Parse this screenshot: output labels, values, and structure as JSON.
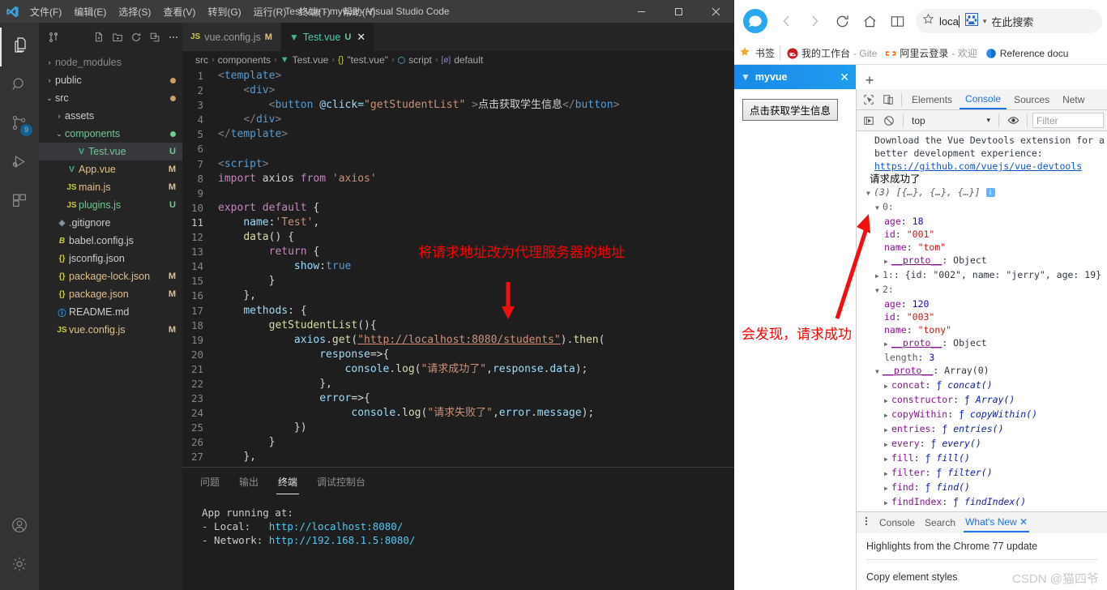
{
  "vscode": {
    "window_title": "Test.vue - myvue - Visual Studio Code",
    "menu": [
      {
        "label": "文件(F)"
      },
      {
        "label": "编辑(E)"
      },
      {
        "label": "选择(S)"
      },
      {
        "label": "查看(V)"
      },
      {
        "label": "转到(G)"
      },
      {
        "label": "运行(R)"
      },
      {
        "label": "终端(T)"
      },
      {
        "label": "帮助(H)"
      }
    ],
    "window_controls": {
      "minimize": "—",
      "maximize": "▭",
      "close": "✕"
    },
    "activitybar": [
      {
        "name": "explorer",
        "icon": "files-icon",
        "badge": ""
      },
      {
        "name": "search",
        "icon": "search-icon",
        "badge": ""
      },
      {
        "name": "source-control",
        "icon": "source-control-icon",
        "badge": "9"
      },
      {
        "name": "run-debug",
        "icon": "run-debug-icon",
        "badge": ""
      },
      {
        "name": "extensions",
        "icon": "extensions-icon",
        "badge": ""
      }
    ],
    "activitybar_bottom": [
      {
        "name": "account",
        "icon": "account-icon"
      },
      {
        "name": "manage",
        "icon": "gear-icon"
      }
    ],
    "explorer_actions": [
      {
        "icon": "new-file-icon"
      },
      {
        "icon": "new-folder-icon"
      },
      {
        "icon": "refresh-icon"
      },
      {
        "icon": "collapse-all-icon"
      },
      {
        "icon": "more-actions-icon"
      }
    ],
    "tree": [
      {
        "label": "node_modules",
        "chevron": "›",
        "icon": "",
        "indent": 0,
        "badge": "",
        "dot": "",
        "color": "#8a8a8a",
        "selected": false
      },
      {
        "label": "public",
        "chevron": "›",
        "icon": "",
        "indent": 0,
        "badge": "",
        "dot": "#c9a06a",
        "color": "#cccccc",
        "selected": false
      },
      {
        "label": "src",
        "chevron": "⌄",
        "icon": "",
        "indent": 0,
        "badge": "",
        "dot": "#c9a06a",
        "color": "#cccccc",
        "selected": false
      },
      {
        "label": "assets",
        "chevron": "›",
        "icon": "",
        "indent": 1,
        "badge": "",
        "dot": "",
        "color": "#cccccc",
        "selected": false
      },
      {
        "label": "components",
        "chevron": "⌄",
        "icon": "",
        "indent": 1,
        "badge": "",
        "dot": "#73c991",
        "color": "#73c991",
        "selected": false
      },
      {
        "label": "Test.vue",
        "chevron": "",
        "icon": "V",
        "indent": 2,
        "badge": "U",
        "dot": "",
        "color": "#73c991",
        "selected": true
      },
      {
        "label": "App.vue",
        "chevron": "",
        "icon": "V",
        "indent": 1,
        "badge": "M",
        "dot": "",
        "color": "#e2c08d",
        "selected": false
      },
      {
        "label": "main.js",
        "chevron": "",
        "icon": "JS",
        "indent": 1,
        "badge": "M",
        "dot": "",
        "color": "#e2c08d",
        "selected": false
      },
      {
        "label": "plugins.js",
        "chevron": "",
        "icon": "JS",
        "indent": 1,
        "badge": "U",
        "dot": "",
        "color": "#73c991",
        "selected": false
      },
      {
        "label": ".gitignore",
        "chevron": "",
        "icon": "◈",
        "indent": 0,
        "badge": "",
        "dot": "",
        "color": "#cccccc",
        "selected": false
      },
      {
        "label": "babel.config.js",
        "chevron": "",
        "icon": "B",
        "indent": 0,
        "badge": "",
        "dot": "",
        "color": "#cccccc",
        "selected": false
      },
      {
        "label": "jsconfig.json",
        "chevron": "",
        "icon": "{}",
        "indent": 0,
        "badge": "",
        "dot": "",
        "color": "#cccccc",
        "selected": false
      },
      {
        "label": "package-lock.json",
        "chevron": "",
        "icon": "{}",
        "indent": 0,
        "badge": "M",
        "dot": "",
        "color": "#e2c08d",
        "selected": false
      },
      {
        "label": "package.json",
        "chevron": "",
        "icon": "{}",
        "indent": 0,
        "badge": "M",
        "dot": "",
        "color": "#e2c08d",
        "selected": false
      },
      {
        "label": "README.md",
        "chevron": "",
        "icon": "ⓘ",
        "indent": 0,
        "badge": "",
        "dot": "",
        "color": "#cccccc",
        "selected": false
      },
      {
        "label": "vue.config.js",
        "chevron": "",
        "icon": "JS",
        "indent": 0,
        "badge": "M",
        "dot": "",
        "color": "#e2c08d",
        "selected": false
      }
    ],
    "tabs": [
      {
        "label": "vue.config.js",
        "icon": "JS",
        "badge": "M",
        "active": false,
        "close": ""
      },
      {
        "label": "Test.vue",
        "icon": "V",
        "badge": "U",
        "active": true,
        "close": "✕"
      }
    ],
    "breadcrumb": [
      "src",
      "components",
      "Test.vue",
      "\"test.vue\"",
      "script",
      "default"
    ],
    "editor": {
      "current_line": 11,
      "lines": [
        {
          "n": 1,
          "indent": 0
        },
        {
          "n": 2,
          "indent": 1
        },
        {
          "n": 3,
          "indent": 2
        },
        {
          "n": 4,
          "indent": 1
        },
        {
          "n": 5,
          "indent": 0
        },
        {
          "n": 6,
          "indent": 0
        },
        {
          "n": 7,
          "indent": 0
        },
        {
          "n": 8,
          "indent": 0
        },
        {
          "n": 9,
          "indent": 0
        },
        {
          "n": 10,
          "indent": 0
        },
        {
          "n": 11,
          "indent": 1
        },
        {
          "n": 12,
          "indent": 1
        },
        {
          "n": 13,
          "indent": 2
        },
        {
          "n": 14,
          "indent": 3
        },
        {
          "n": 15,
          "indent": 2
        },
        {
          "n": 16,
          "indent": 1
        },
        {
          "n": 17,
          "indent": 1
        },
        {
          "n": 18,
          "indent": 2
        },
        {
          "n": 19,
          "indent": 3
        },
        {
          "n": 20,
          "indent": 4
        },
        {
          "n": 21,
          "indent": 5
        },
        {
          "n": 22,
          "indent": 4
        },
        {
          "n": 23,
          "indent": 4
        },
        {
          "n": 24,
          "indent": 5
        },
        {
          "n": 25,
          "indent": 3
        },
        {
          "n": 26,
          "indent": 2
        },
        {
          "n": 27,
          "indent": 1
        }
      ],
      "button_text": "点击获取学生信息",
      "click_attr": "@click=",
      "click_value": "\"getStudentList\"",
      "name_value": "'Test'",
      "import_line": "import axios from 'axios'",
      "request_url": "\"http://localhost:8080/students\"",
      "log_success": "\"请求成功了\"",
      "log_fail": "\"请求失败了\""
    },
    "panel": {
      "tabs": [
        {
          "label": "问题",
          "active": false
        },
        {
          "label": "输出",
          "active": false
        },
        {
          "label": "终端",
          "active": true
        },
        {
          "label": "调试控制台",
          "active": false
        }
      ],
      "terminal": [
        {
          "text": "App running at:",
          "url": ""
        },
        {
          "text": "- Local:   ",
          "url": "http://localhost:8080/"
        },
        {
          "text": "- Network: ",
          "url": "http://192.168.1.5:8080/"
        }
      ]
    },
    "annotations": [
      {
        "name": "annotation-proxy-note",
        "text": "将请求地址改为代理服务器的地址"
      }
    ]
  },
  "browser": {
    "app": "qq-browser",
    "nav": [
      {
        "name": "back",
        "icon": "chevron-left-icon"
      },
      {
        "name": "forward",
        "icon": "chevron-right-icon"
      },
      {
        "name": "reload",
        "icon": "reload-icon"
      },
      {
        "name": "home",
        "icon": "home-icon"
      },
      {
        "name": "reading-mode",
        "icon": "book-icon"
      }
    ],
    "url_value": "loca",
    "search_placeholder": "在此搜索",
    "search_engine": "baidu-icon",
    "bookmarks_label": "书签",
    "bookmarks": [
      {
        "label": "我的工作台",
        "sub": "- Gite",
        "icon": "gitee-icon",
        "color": "#c71d23"
      },
      {
        "label": "阿里云登录",
        "sub": "- 欢迎",
        "icon": "aliyun-icon",
        "color": "#ff6a00"
      },
      {
        "label": "Reference docu",
        "sub": "",
        "icon": "globe-icon",
        "color": "#2d8cf0"
      }
    ],
    "tab": {
      "label": "myvue",
      "icon": "vue-icon",
      "close": "✕"
    },
    "newtab": "+",
    "page": {
      "button_label": "点击获取学生信息"
    }
  },
  "devtools": {
    "tabs": [
      {
        "label": "Elements",
        "active": false
      },
      {
        "label": "Console",
        "active": true
      },
      {
        "label": "Sources",
        "active": false
      },
      {
        "label": "Netw",
        "active": false
      }
    ],
    "toolbar_icons": [
      {
        "name": "inspect-element-icon"
      },
      {
        "name": "device-toolbar-icon"
      }
    ],
    "filterbar": {
      "execute_icon": "execute-icon",
      "clear_icon": "clear-console-icon",
      "context": "top",
      "chevron": "▾",
      "eye_icon": "eye-icon",
      "filter_placeholder": "Filter"
    },
    "console": {
      "vue_notice_1": "Download the Vue Devtools extension for a ",
      "vue_notice_link_tail": "b",
      "vue_notice_2": "better development experience:",
      "vue_notice_url": "https://github.com/vuejs/vue-devtools",
      "log_label": "请求成功了",
      "array_summary": "(3) [{…}, {…}, {…}]",
      "items": [
        {
          "kind": "expand",
          "tri": "▼",
          "key": "0:",
          "indent": 1
        },
        {
          "kind": "prop",
          "key": "age",
          "value": "18",
          "vtype": "num",
          "indent": 2
        },
        {
          "kind": "prop",
          "key": "id",
          "value": "\"001\"",
          "vtype": "str",
          "indent": 2
        },
        {
          "kind": "prop",
          "key": "name",
          "value": "\"tom\"",
          "vtype": "str",
          "indent": 2
        },
        {
          "kind": "proto",
          "tri": "▶",
          "key": "__proto__",
          "value": "Object",
          "indent": 2
        },
        {
          "kind": "inline",
          "tri": "▶",
          "key": "1:",
          "value": "{id: \"002\", name: \"jerry\", age: 19}",
          "indent": 1
        },
        {
          "kind": "expand",
          "tri": "▼",
          "key": "2:",
          "indent": 1
        },
        {
          "kind": "prop",
          "key": "age",
          "value": "120",
          "vtype": "num",
          "indent": 2
        },
        {
          "kind": "prop",
          "key": "id",
          "value": "\"003\"",
          "vtype": "str",
          "indent": 2
        },
        {
          "kind": "prop",
          "key": "name",
          "value": "\"tony\"",
          "vtype": "str",
          "indent": 2
        },
        {
          "kind": "proto",
          "tri": "▶",
          "key": "__proto__",
          "value": "Object",
          "indent": 2
        },
        {
          "kind": "length",
          "key": "length",
          "value": "3",
          "vtype": "num",
          "indent": 2
        },
        {
          "kind": "protoarr",
          "tri": "▼",
          "key": "__proto__",
          "value": "Array(0)",
          "indent": 1
        },
        {
          "kind": "fn",
          "tri": "▶",
          "key": "concat",
          "value": "concat()",
          "indent": 2
        },
        {
          "kind": "fn",
          "tri": "▶",
          "key": "constructor",
          "value": "Array()",
          "indent": 2
        },
        {
          "kind": "fn",
          "tri": "▶",
          "key": "copyWithin",
          "value": "copyWithin()",
          "indent": 2
        },
        {
          "kind": "fn",
          "tri": "▶",
          "key": "entries",
          "value": "entries()",
          "indent": 2
        },
        {
          "kind": "fn",
          "tri": "▶",
          "key": "every",
          "value": "every()",
          "indent": 2
        },
        {
          "kind": "fn",
          "tri": "▶",
          "key": "fill",
          "value": "fill()",
          "indent": 2
        },
        {
          "kind": "fn",
          "tri": "▶",
          "key": "filter",
          "value": "filter()",
          "indent": 2
        },
        {
          "kind": "fn",
          "tri": "▶",
          "key": "find",
          "value": "find()",
          "indent": 2
        },
        {
          "kind": "fn",
          "tri": "▶",
          "key": "findIndex",
          "value": "findIndex()",
          "indent": 2
        }
      ]
    },
    "drawer": {
      "menu_icon": "more-vertical-icon",
      "tabs": [
        {
          "label": "Console",
          "active": false,
          "close": ""
        },
        {
          "label": "Search",
          "active": false,
          "close": ""
        },
        {
          "label": "What's New",
          "active": true,
          "close": "✕"
        }
      ],
      "headline": "Highlights from the Chrome 77 update",
      "items": [
        {
          "label": "Copy element styles"
        }
      ]
    },
    "annotations": [
      {
        "name": "annotation-success-note",
        "text": "会发现，请求成功"
      }
    ]
  },
  "watermark": "CSDN @猫四爷"
}
